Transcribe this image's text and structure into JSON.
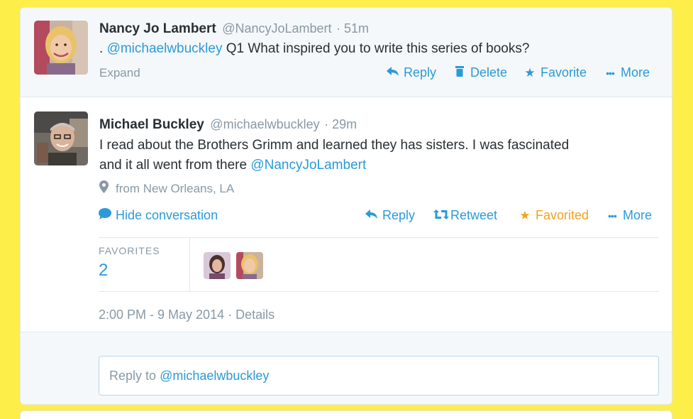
{
  "tweet1": {
    "name": "Nancy Jo Lambert",
    "handle": "@NancyJoLambert",
    "time": "· 51m",
    "text_prefix": ".",
    "mention": "@michaelwbuckley",
    "text_rest": "Q1 What inspired you to write this series of books?",
    "expand": "Expand",
    "actions": {
      "reply": "Reply",
      "delete": "Delete",
      "favorite": "Favorite",
      "more": "More"
    }
  },
  "tweet2": {
    "name": "Michael Buckley",
    "handle": "@michaelwbuckley",
    "time": "· 29m",
    "text_line1": "I read about the Brothers Grimm and learned they has sisters.  I was fascinated",
    "text_line2": "and it all went from there",
    "mention": "@NancyJoLambert",
    "location": "from New Orleans, LA",
    "hide_conversation": "Hide conversation",
    "actions": {
      "reply": "Reply",
      "retweet": "Retweet",
      "favorited": "Favorited",
      "more": "More"
    },
    "favorites_label": "FAVORITES",
    "favorites_count": "2",
    "timestamp": "2:00 PM - 9 May 2014",
    "details": "· Details"
  },
  "reply_box": {
    "prefix": "Reply to",
    "mention": "@michaelwbuckley"
  },
  "colors": {
    "background": "#fdee4a",
    "link": "#2b9ad8",
    "favorited": "#f4a11d",
    "muted": "#8899a6"
  }
}
